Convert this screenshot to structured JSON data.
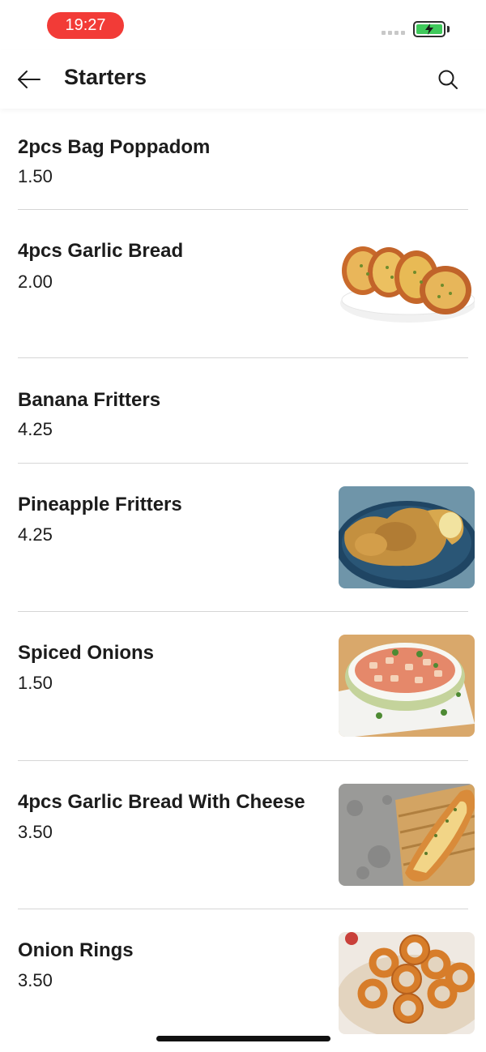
{
  "status_bar": {
    "time": "19:27"
  },
  "header": {
    "title": "Starters"
  },
  "items": [
    {
      "name": "2pcs Bag Poppadom",
      "price": "1.50",
      "image": null
    },
    {
      "name": "4pcs Garlic Bread",
      "price": "2.00",
      "image": "garlic-bread-photo"
    },
    {
      "name": "Banana Fritters",
      "price": "4.25",
      "image": null
    },
    {
      "name": "Pineapple Fritters",
      "price": "4.25",
      "image": "pineapple-fritters-photo"
    },
    {
      "name": "Spiced Onions",
      "price": "1.50",
      "image": "spiced-onions-photo"
    },
    {
      "name": "4pcs Garlic Bread With Cheese",
      "price": "3.50",
      "image": "garlic-bread-cheese-photo"
    },
    {
      "name": "Onion Rings",
      "price": "3.50",
      "image": "onion-rings-photo"
    }
  ],
  "colors": {
    "time_pill": "#f23b37",
    "battery": "#3fc95b",
    "divider": "#d6d6d6"
  }
}
